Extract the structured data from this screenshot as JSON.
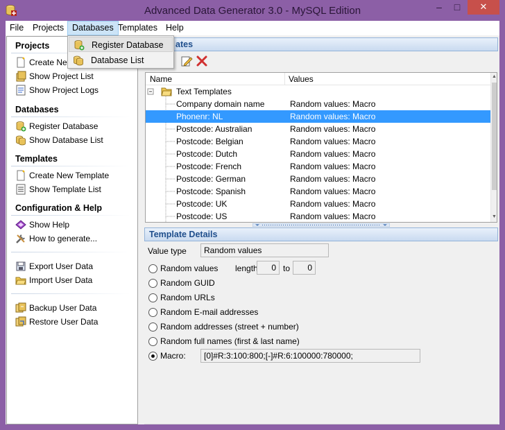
{
  "window": {
    "title": "Advanced Data Generator 3.0 - MySQL Edition",
    "min_glyph": "–",
    "max_glyph": "□",
    "close_glyph": "✕",
    "frame_color": "#8c5fa6"
  },
  "menubar": {
    "items": [
      {
        "label": "File"
      },
      {
        "label": "Projects"
      },
      {
        "label": "Databases"
      },
      {
        "label": "Templates"
      },
      {
        "label": "Help"
      }
    ],
    "open_menu": "Databases"
  },
  "dropdown": {
    "items": [
      {
        "label": "Register Database",
        "icon": "register-database-icon"
      },
      {
        "label": "Database List",
        "icon": "database-list-icon"
      }
    ]
  },
  "sidebar": {
    "sections": [
      {
        "header": "Projects",
        "items": [
          "Create New",
          "Show Project List",
          "Show Project Logs"
        ]
      },
      {
        "header": "Databases",
        "items": [
          "Register Database",
          "Show Database List"
        ]
      },
      {
        "header": "Templates",
        "items": [
          "Create  New Template",
          "Show Template List"
        ]
      },
      {
        "header": "Configuration & Help",
        "items": [
          "Show Help",
          "How to generate..."
        ]
      }
    ],
    "extra_items": [
      "Export User Data",
      "Import User Data",
      "Backup User Data",
      "Restore User Data"
    ]
  },
  "templates_panel": {
    "header": "Templates",
    "header_visible": "ates",
    "columns": [
      "Name",
      "Values"
    ],
    "root": "Text Templates",
    "rows": [
      {
        "name": "Company domain name",
        "value": "Random values: Macro",
        "selected": false
      },
      {
        "name": "Phonenr: NL",
        "value": "Random values: Macro",
        "selected": true
      },
      {
        "name": "Postcode: Australian",
        "value": "Random values: Macro",
        "selected": false
      },
      {
        "name": "Postcode: Belgian",
        "value": "Random values: Macro",
        "selected": false
      },
      {
        "name": "Postcode: Dutch",
        "value": "Random values: Macro",
        "selected": false
      },
      {
        "name": "Postcode: French",
        "value": "Random values: Macro",
        "selected": false
      },
      {
        "name": "Postcode: German",
        "value": "Random values: Macro",
        "selected": false
      },
      {
        "name": "Postcode: Spanish",
        "value": "Random values: Macro",
        "selected": false
      },
      {
        "name": "Postcode: UK",
        "value": "Random values: Macro",
        "selected": false
      },
      {
        "name": "Postcode: US",
        "value": "Random values: Macro",
        "selected": false
      }
    ],
    "selection_color": "#3399ff"
  },
  "details": {
    "header": "Template Details",
    "value_type_label": "Value type",
    "value_type": "Random values",
    "length_label": "length",
    "to_label": "to",
    "length_from": "0",
    "length_to": "0",
    "options": [
      {
        "label": "Random values",
        "checked": false
      },
      {
        "label": "Random GUID",
        "checked": false
      },
      {
        "label": "Random URLs",
        "checked": false
      },
      {
        "label": "Random E-mail addresses",
        "checked": false
      },
      {
        "label": "Random addresses (street + number)",
        "checked": false
      },
      {
        "label": "Random full names (first & last name)",
        "checked": false
      },
      {
        "label": "Macro:",
        "checked": true
      }
    ],
    "macro": "[0]#R:3:100:800;[-]#R:6:100000:780000;"
  },
  "colors": {
    "header_text": "#1f4e8c",
    "delete_red": "#d03030"
  }
}
